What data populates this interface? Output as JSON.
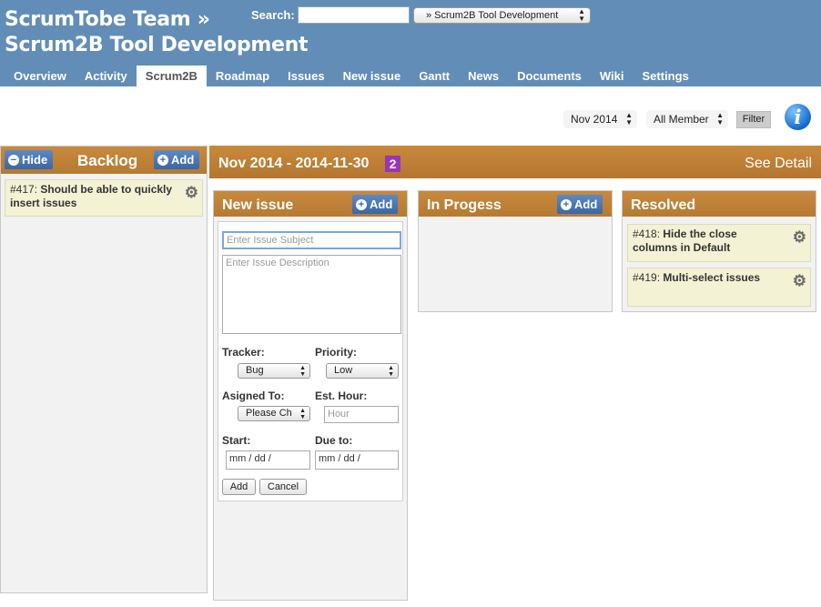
{
  "header": {
    "title_line1": "ScrumTobe Team »",
    "title_line2": "Scrum2B Tool Development",
    "search_label": "Search:",
    "search_value": "",
    "project_select": "» Scrum2B Tool Development"
  },
  "tabs": [
    {
      "label": "Overview"
    },
    {
      "label": "Activity"
    },
    {
      "label": "Scrum2B",
      "active": true
    },
    {
      "label": "Roadmap"
    },
    {
      "label": "Issues"
    },
    {
      "label": "New issue"
    },
    {
      "label": "Gantt"
    },
    {
      "label": "News"
    },
    {
      "label": "Documents"
    },
    {
      "label": "Wiki"
    },
    {
      "label": "Settings"
    }
  ],
  "filters": {
    "sprint": "Nov 2014",
    "member": "All Member",
    "filter_button": "Filter",
    "info_icon": "i"
  },
  "backlog": {
    "hide_label": "Hide",
    "title": "Backlog",
    "add_label": "Add",
    "cards": [
      {
        "id": "#417:",
        "text": "Should be able to quickly insert issues"
      }
    ]
  },
  "sprint": {
    "title": "Nov 2014 - 2014-11-30",
    "count": "2",
    "see_detail": "See Detail"
  },
  "columns": {
    "new_issue": {
      "title": "New issue",
      "add_label": "Add"
    },
    "in_progress": {
      "title": "In Progess",
      "add_label": "Add"
    },
    "resolved": {
      "title": "Resolved",
      "cards": [
        {
          "id": "#418:",
          "text": "Hide the close columns in Default"
        },
        {
          "id": "#419:",
          "text": "Multi-select issues"
        }
      ]
    }
  },
  "form": {
    "subject_placeholder": "Enter Issue Subject",
    "description_placeholder": "Enter Issue Description",
    "tracker_label": "Tracker:",
    "tracker_value": "Bug",
    "priority_label": "Priority:",
    "priority_value": "Low",
    "assigned_label": "Asigned To:",
    "assigned_value": "Please Ch",
    "est_label": "Est. Hour:",
    "est_placeholder": "Hour",
    "start_label": "Start:",
    "start_placeholder": "mm / dd /",
    "due_label": "Due to:",
    "due_placeholder": "mm / dd /",
    "add_button": "Add",
    "cancel_button": "Cancel"
  },
  "colors": {
    "header_bg": "#628db6",
    "column_head": "#c0843a",
    "button_blue": "#3b67a5",
    "card_bg": "#f4f2d5",
    "badge": "#9b34b5"
  }
}
